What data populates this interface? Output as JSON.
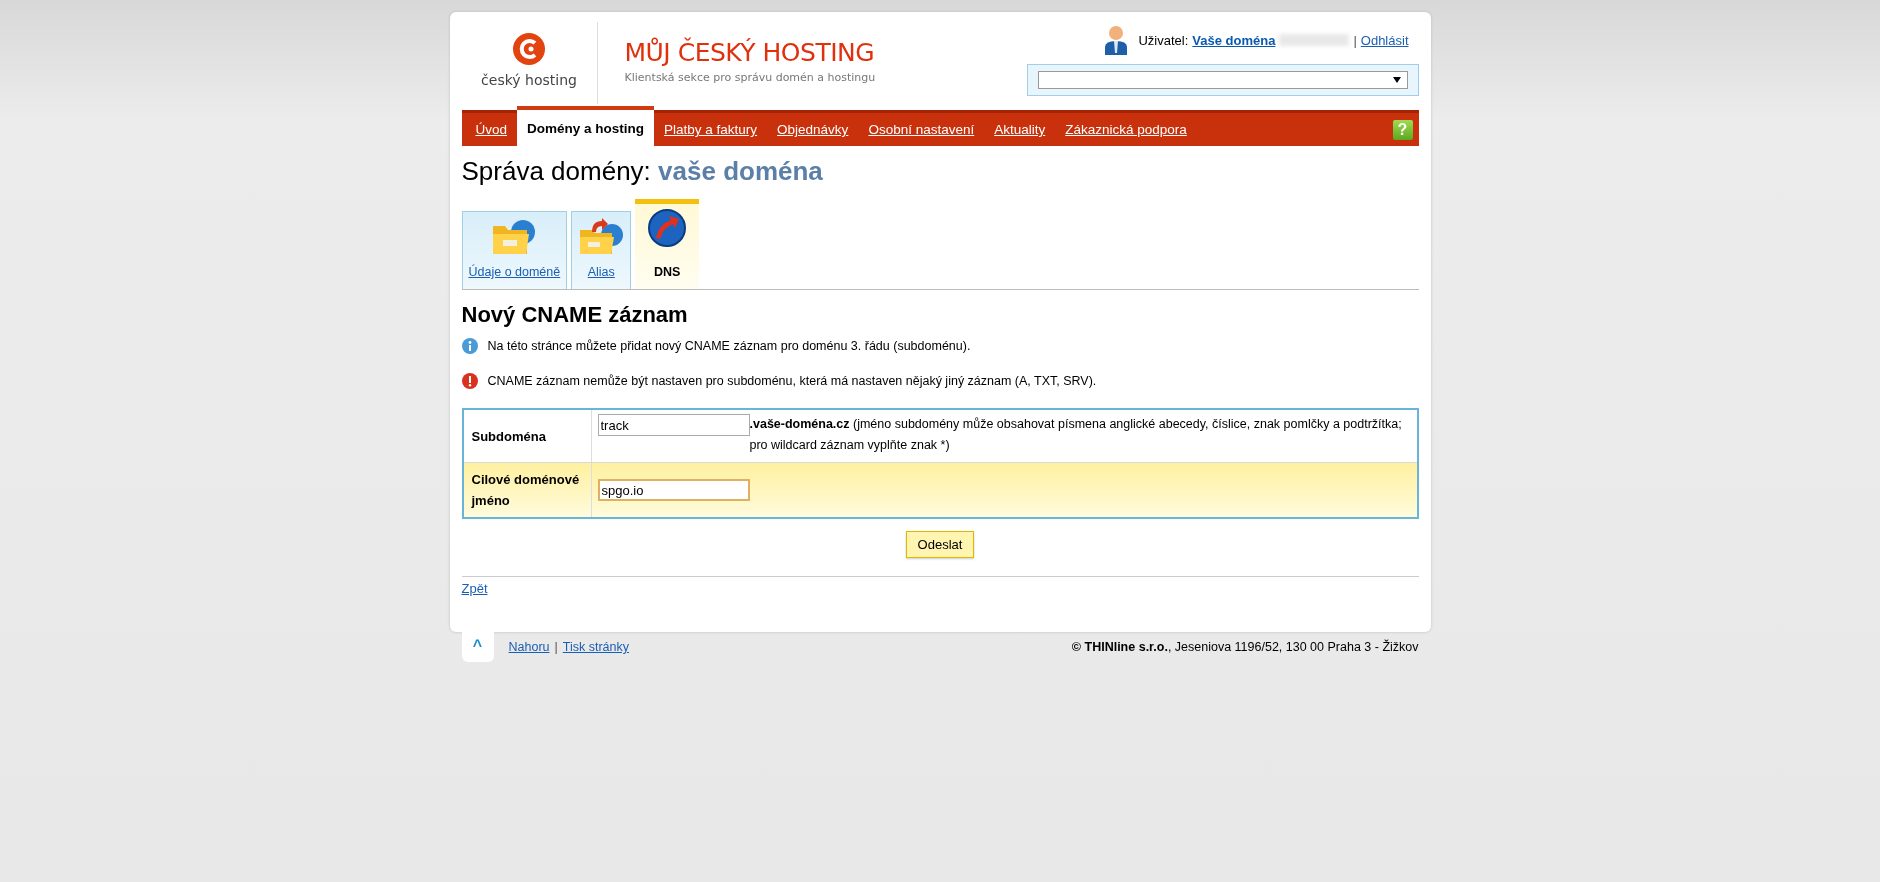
{
  "logo": {
    "text": "český hosting"
  },
  "brand": {
    "title": "MŮJ ČESKÝ HOSTING",
    "subtitle": "Klientská sekce pro správu domén a hostingu"
  },
  "user": {
    "label": "Uživatel:",
    "name": "Vaše doména",
    "separator": "|",
    "logout": "Odhlásit"
  },
  "nav": [
    {
      "label": "Úvod",
      "selected": false
    },
    {
      "label": "Domény a hosting",
      "selected": true
    },
    {
      "label": "Platby a faktury",
      "selected": false
    },
    {
      "label": "Objednávky",
      "selected": false
    },
    {
      "label": "Osobní nastavení",
      "selected": false
    },
    {
      "label": "Aktuality",
      "selected": false
    },
    {
      "label": "Zákaznická podpora",
      "selected": false
    }
  ],
  "help": "?",
  "page_title": {
    "prefix": "Správa domény:",
    "domain": "vaše doména"
  },
  "tabs": [
    {
      "label": "Údaje o doméně",
      "selected": false,
      "kind": "folder"
    },
    {
      "label": "Alias",
      "selected": false,
      "kind": "alias"
    },
    {
      "label": "DNS",
      "selected": true,
      "kind": "dns"
    }
  ],
  "heading": "Nový CNAME záznam",
  "messages": [
    {
      "kind": "info",
      "text": "Na této stránce můžete přidat nový CNAME záznam pro doménu 3. řádu (subdoménu)."
    },
    {
      "kind": "error",
      "text": "CNAME záznam nemůže být nastaven pro subdoménu, která má nastaven nějaký jiný záznam (A, TXT, SRV)."
    }
  ],
  "form": [
    {
      "label": "Subdoména",
      "value": "track",
      "focused": false,
      "hint": "**.vaše-doména.cz** (jméno subdomény může obsahovat písmena anglické abecedy, číslice, znak pomlčky a podtržítka; pro wildcard záznam vyplňte znak *)"
    },
    {
      "label": "Cilové doménové jméno",
      "value": "spgo.io",
      "focused": true
    }
  ],
  "submit": "Odeslat",
  "back": "Zpět",
  "footer": {
    "up": "^",
    "links": [
      "Nahoru",
      "Tisk stránky"
    ],
    "separator": "|",
    "copyright": "**© THINline s.r.o.**, Jeseniova 1196/52, 130 00 Praha 3 - Žižkov"
  }
}
